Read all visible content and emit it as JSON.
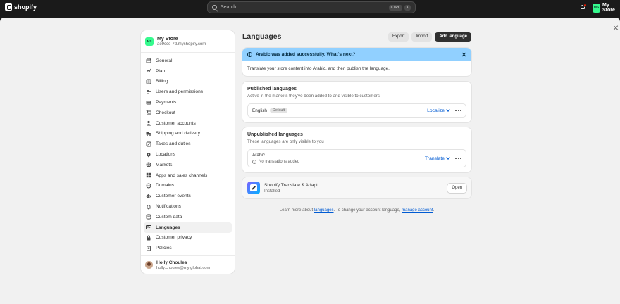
{
  "topbar": {
    "brand": "shopify",
    "search_placeholder": "Search",
    "shortcut_keys": [
      "CTRL",
      "K"
    ],
    "store_initials": "MS",
    "store_name": "My Store"
  },
  "sidebar": {
    "store_initials": "MS",
    "store_name": "My Store",
    "store_domain": "ae9cce-7d.myshopify.com",
    "items": [
      {
        "label": "General",
        "icon": "store-icon"
      },
      {
        "label": "Plan",
        "icon": "plan-icon"
      },
      {
        "label": "Billing",
        "icon": "billing-icon"
      },
      {
        "label": "Users and permissions",
        "icon": "users-icon"
      },
      {
        "label": "Payments",
        "icon": "payments-icon"
      },
      {
        "label": "Checkout",
        "icon": "cart-icon"
      },
      {
        "label": "Customer accounts",
        "icon": "person-icon"
      },
      {
        "label": "Shipping and delivery",
        "icon": "truck-icon"
      },
      {
        "label": "Taxes and duties",
        "icon": "tax-icon"
      },
      {
        "label": "Locations",
        "icon": "location-icon"
      },
      {
        "label": "Markets",
        "icon": "globe-icon"
      },
      {
        "label": "Apps and sales channels",
        "icon": "apps-icon"
      },
      {
        "label": "Domains",
        "icon": "domain-icon"
      },
      {
        "label": "Customer events",
        "icon": "events-icon"
      },
      {
        "label": "Notifications",
        "icon": "bell-icon"
      },
      {
        "label": "Custom data",
        "icon": "data-icon"
      },
      {
        "label": "Languages",
        "icon": "language-icon",
        "active": true
      },
      {
        "label": "Customer privacy",
        "icon": "privacy-icon"
      },
      {
        "label": "Policies",
        "icon": "policy-icon"
      }
    ],
    "user": {
      "name": "Holly Choules",
      "email": "holly.choules@mytglobal.com"
    }
  },
  "page": {
    "title": "Languages",
    "actions": {
      "export": "Export",
      "import": "Import",
      "add": "Add language"
    },
    "banner": {
      "title": "Arabic was added successfully. What's next?",
      "body": "Translate your store content into Arabic, and then publish the language."
    },
    "published": {
      "title": "Published languages",
      "subtitle": "Active in the markets they've been added to and visible to customers",
      "language": "English",
      "badge": "Default",
      "action": "Localize"
    },
    "unpublished": {
      "title": "Unpublished languages",
      "subtitle": "These languages are only visible to you",
      "language": "Arabic",
      "status": "No translations added",
      "action": "Translate"
    },
    "app": {
      "name": "Shopify Translate & Adapt",
      "status": "Installed",
      "action": "Open"
    },
    "footer": {
      "prefix": "Learn more about ",
      "link1": "languages",
      "middle": ". To change your account language, ",
      "link2": "manage account",
      "suffix": "."
    }
  }
}
